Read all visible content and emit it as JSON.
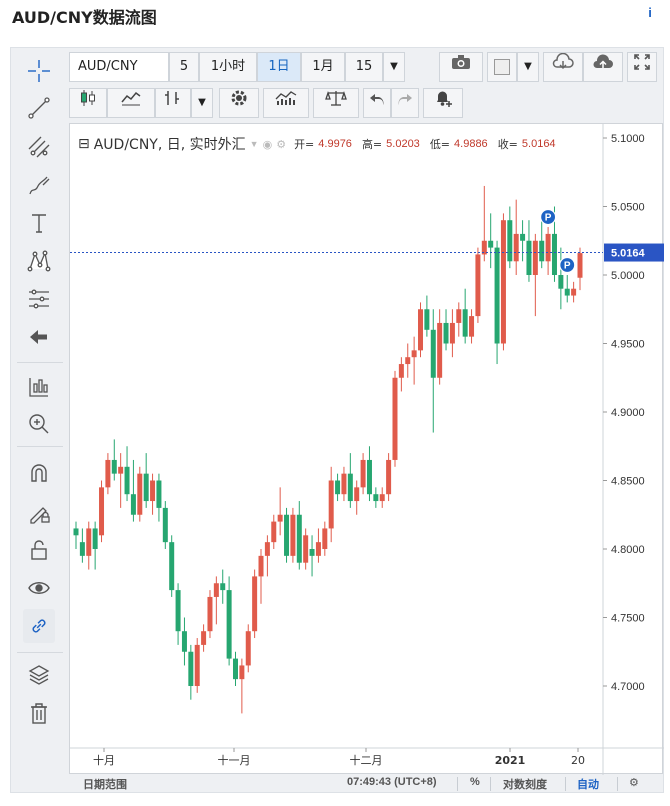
{
  "page_title": "AUD/CNY数据流图",
  "toolbar": {
    "symbol": "AUD/CNY",
    "interval_value": "5",
    "interval_1h": "1小时",
    "interval_1d": "1日",
    "interval_1m": "1月",
    "interval_15": "15"
  },
  "legend": {
    "symbol": "AUD/CNY, 日, 实时外汇",
    "open_label": "开=",
    "open": "4.9976",
    "high_label": "高=",
    "high": "5.0203",
    "low_label": "低=",
    "low": "4.9886",
    "close_label": "收=",
    "close": "5.0164"
  },
  "price_axis": [
    "5.1000",
    "5.0500",
    "5.0000",
    "4.9500",
    "4.9000",
    "4.8500",
    "4.8000",
    "4.7500",
    "4.7000"
  ],
  "last_price_label": "5.0164",
  "time_axis": [
    "十月",
    "十一月",
    "十二月",
    "2021",
    "20"
  ],
  "bottom_bar": {
    "date_range": "日期范围",
    "time": "07:49:43 (UTC+8)",
    "percent": "%",
    "log_scale": "对数刻度",
    "auto": "自动"
  },
  "colors": {
    "up": "#e05b4b",
    "down": "#26a670",
    "accent": "#1e63c4"
  },
  "chart_data": {
    "type": "candlestick",
    "ylim": [
      4.675,
      5.108
    ],
    "ohlc": [
      [
        4.815,
        4.82,
        4.8,
        4.81
      ],
      [
        4.805,
        4.815,
        4.79,
        4.795
      ],
      [
        4.795,
        4.82,
        4.785,
        4.815
      ],
      [
        4.815,
        4.82,
        4.785,
        4.8
      ],
      [
        4.81,
        4.85,
        4.805,
        4.845
      ],
      [
        4.845,
        4.87,
        4.84,
        4.865
      ],
      [
        4.865,
        4.88,
        4.85,
        4.855
      ],
      [
        4.855,
        4.87,
        4.83,
        4.86
      ],
      [
        4.86,
        4.875,
        4.835,
        4.84
      ],
      [
        4.84,
        4.865,
        4.82,
        4.825
      ],
      [
        4.825,
        4.86,
        4.82,
        4.855
      ],
      [
        4.855,
        4.87,
        4.83,
        4.835
      ],
      [
        4.835,
        4.855,
        4.825,
        4.85
      ],
      [
        4.85,
        4.855,
        4.82,
        4.83
      ],
      [
        4.83,
        4.835,
        4.8,
        4.805
      ],
      [
        4.805,
        4.81,
        4.765,
        4.77
      ],
      [
        4.77,
        4.775,
        4.73,
        4.74
      ],
      [
        4.74,
        4.75,
        4.715,
        4.725
      ],
      [
        4.725,
        4.73,
        4.69,
        4.7
      ],
      [
        4.7,
        4.735,
        4.695,
        4.73
      ],
      [
        4.73,
        4.745,
        4.725,
        4.74
      ],
      [
        4.74,
        4.77,
        4.735,
        4.765
      ],
      [
        4.765,
        4.78,
        4.745,
        4.775
      ],
      [
        4.775,
        4.785,
        4.76,
        4.77
      ],
      [
        4.77,
        4.78,
        4.715,
        4.72
      ],
      [
        4.72,
        4.725,
        4.7,
        4.705
      ],
      [
        4.705,
        4.72,
        4.68,
        4.715
      ],
      [
        4.715,
        4.745,
        4.71,
        4.74
      ],
      [
        4.74,
        4.785,
        4.735,
        4.78
      ],
      [
        4.78,
        4.8,
        4.76,
        4.795
      ],
      [
        4.795,
        4.81,
        4.78,
        4.805
      ],
      [
        4.805,
        4.825,
        4.8,
        4.82
      ],
      [
        4.82,
        4.845,
        4.81,
        4.825
      ],
      [
        4.825,
        4.83,
        4.79,
        4.795
      ],
      [
        4.795,
        4.83,
        4.79,
        4.825
      ],
      [
        4.825,
        4.835,
        4.785,
        4.79
      ],
      [
        4.79,
        4.815,
        4.785,
        4.81
      ],
      [
        4.8,
        4.81,
        4.78,
        4.795
      ],
      [
        4.795,
        4.815,
        4.79,
        4.805
      ],
      [
        4.8,
        4.82,
        4.795,
        4.815
      ],
      [
        4.815,
        4.86,
        4.805,
        4.85
      ],
      [
        4.85,
        4.855,
        4.835,
        4.84
      ],
      [
        4.84,
        4.86,
        4.835,
        4.855
      ],
      [
        4.855,
        4.87,
        4.83,
        4.835
      ],
      [
        4.835,
        4.85,
        4.825,
        4.845
      ],
      [
        4.845,
        4.87,
        4.84,
        4.865
      ],
      [
        4.865,
        4.875,
        4.835,
        4.84
      ],
      [
        4.84,
        4.845,
        4.83,
        4.835
      ],
      [
        4.835,
        4.845,
        4.83,
        4.84
      ],
      [
        4.84,
        4.87,
        4.835,
        4.865
      ],
      [
        4.865,
        4.93,
        4.86,
        4.925
      ],
      [
        4.925,
        4.94,
        4.915,
        4.935
      ],
      [
        4.935,
        4.95,
        4.925,
        4.94
      ],
      [
        4.94,
        4.955,
        4.92,
        4.945
      ],
      [
        4.945,
        4.98,
        4.94,
        4.975
      ],
      [
        4.975,
        4.985,
        4.955,
        4.96
      ],
      [
        4.96,
        4.975,
        4.885,
        4.925
      ],
      [
        4.925,
        4.975,
        4.92,
        4.965
      ],
      [
        4.965,
        4.975,
        4.945,
        4.95
      ],
      [
        4.95,
        4.975,
        4.94,
        4.965
      ],
      [
        4.965,
        4.98,
        4.955,
        4.975
      ],
      [
        4.975,
        4.99,
        4.95,
        4.955
      ],
      [
        4.955,
        4.975,
        4.95,
        4.97
      ],
      [
        4.97,
        5.02,
        4.965,
        5.015
      ],
      [
        5.015,
        5.065,
        5.01,
        5.025
      ],
      [
        5.025,
        5.045,
        5.005,
        5.02
      ],
      [
        5.02,
        5.025,
        4.935,
        4.95
      ],
      [
        4.95,
        5.045,
        4.945,
        5.04
      ],
      [
        5.04,
        5.05,
        5.005,
        5.01
      ],
      [
        5.01,
        5.055,
        5.0,
        5.03
      ],
      [
        5.03,
        5.04,
        5.01,
        5.025
      ],
      [
        5.025,
        5.04,
        4.995,
        5.0
      ],
      [
        5.0,
        5.03,
        4.97,
        5.025
      ],
      [
        5.025,
        5.04,
        5.005,
        5.01
      ],
      [
        5.01,
        5.035,
        5.0,
        5.03
      ],
      [
        5.03,
        5.05,
        4.995,
        5.0
      ],
      [
        5.0,
        5.02,
        4.975,
        4.99
      ],
      [
        4.99,
        5.0,
        4.98,
        4.985
      ],
      [
        4.985,
        4.995,
        4.98,
        4.99
      ],
      [
        4.998,
        5.02,
        4.989,
        5.016
      ]
    ],
    "markers": [
      {
        "index": 74,
        "label": "P"
      },
      {
        "index": 77,
        "label": "P"
      }
    ]
  }
}
